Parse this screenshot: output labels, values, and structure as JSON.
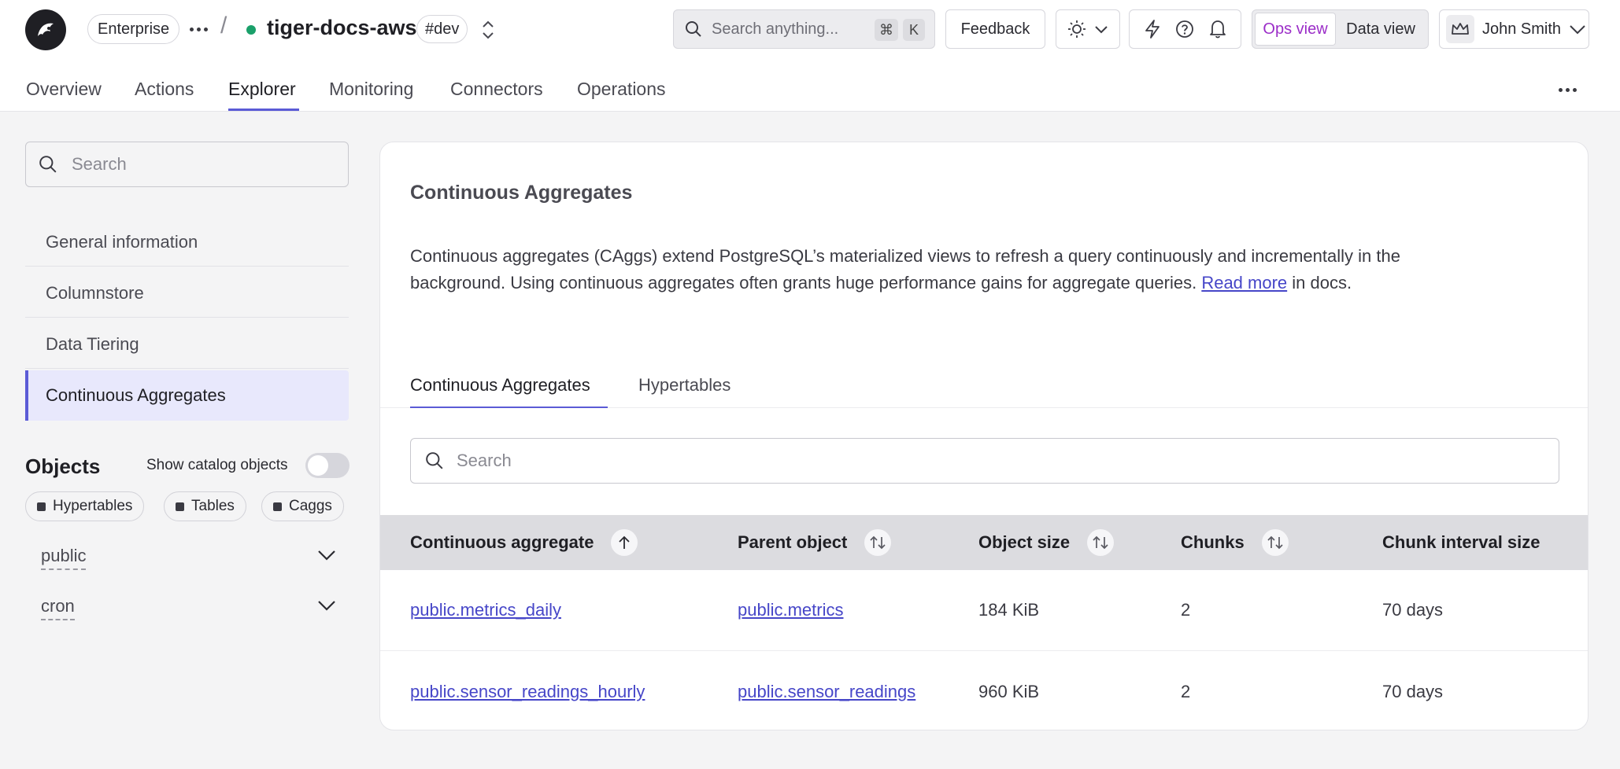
{
  "header": {
    "plan": "Enterprise",
    "service_name": "tiger-docs-aws",
    "env_tag": "#dev",
    "search_placeholder": "Search anything...",
    "shortcut_cmd": "⌘",
    "shortcut_key": "K",
    "feedback_label": "Feedback",
    "ops_view_label": "Ops view",
    "data_view_label": "Data view",
    "user_name": "John Smith",
    "status_color": "#1aa06a",
    "accent_color": "#5b5bd6"
  },
  "nav": {
    "tabs": [
      "Overview",
      "Actions",
      "Explorer",
      "Monitoring",
      "Connectors",
      "Operations"
    ],
    "active": "Explorer"
  },
  "sidebar": {
    "search_placeholder": "Search",
    "items": [
      "General information",
      "Columnstore",
      "Data Tiering",
      "Continuous Aggregates"
    ],
    "active_item": "Continuous Aggregates",
    "objects_title": "Objects",
    "show_catalog_label": "Show catalog objects",
    "show_catalog_on": false,
    "filters": [
      "Hypertables",
      "Tables",
      "Caggs"
    ],
    "schemas": [
      "public",
      "cron"
    ]
  },
  "main": {
    "title": "Continuous Aggregates",
    "description_before": "Continuous aggregates (CAggs) extend PostgreSQL’s materialized views to refresh a query continuously and incrementally in the background. Using continuous aggregates often grants huge performance gains for aggregate queries. ",
    "read_more": "Read more",
    "description_after": " in docs.",
    "tabs": [
      "Continuous Aggregates",
      "Hypertables"
    ],
    "active_tab": "Continuous Aggregates",
    "table_search_placeholder": "Search",
    "columns": [
      "Continuous aggregate",
      "Parent object",
      "Object size",
      "Chunks",
      "Chunk interval size"
    ],
    "rows": [
      {
        "name": "public.metrics_daily",
        "parent": "public.metrics",
        "size": "184 KiB",
        "chunks": "2",
        "interval": "70 days"
      },
      {
        "name": "public.sensor_readings_hourly",
        "parent": "public.sensor_readings",
        "size": "960 KiB",
        "chunks": "2",
        "interval": "70 days"
      }
    ]
  }
}
